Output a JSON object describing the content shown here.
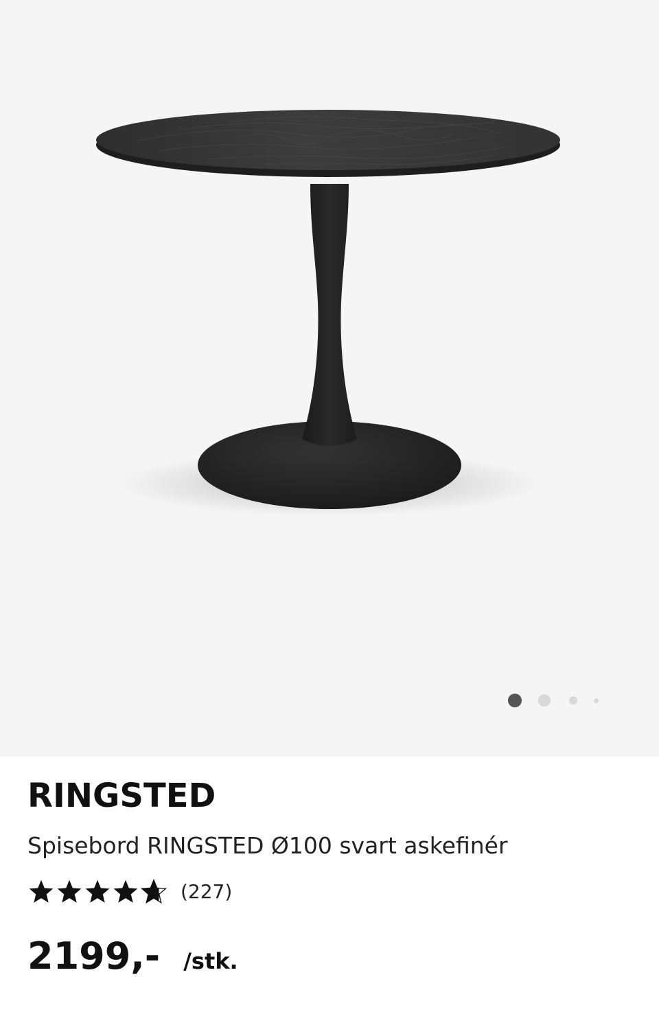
{
  "gallery": {
    "image_alt": "Spisebord RINGSTED Ø100 svart askefinér",
    "active_index": 1,
    "total_images": 4,
    "colors": {
      "background": "#f5f5f5",
      "table": "#2b2b2b",
      "dot_active": "#555555",
      "dot_inactive": "#d8d8d8"
    }
  },
  "product": {
    "name": "RINGSTED",
    "description": "Spisebord RINGSTED Ø100 svart askefinér",
    "rating": {
      "value": 4.5,
      "max": 5,
      "icon": "star-icon",
      "count_label": "(227)"
    },
    "price": "2199,-",
    "unit": "/stk."
  }
}
